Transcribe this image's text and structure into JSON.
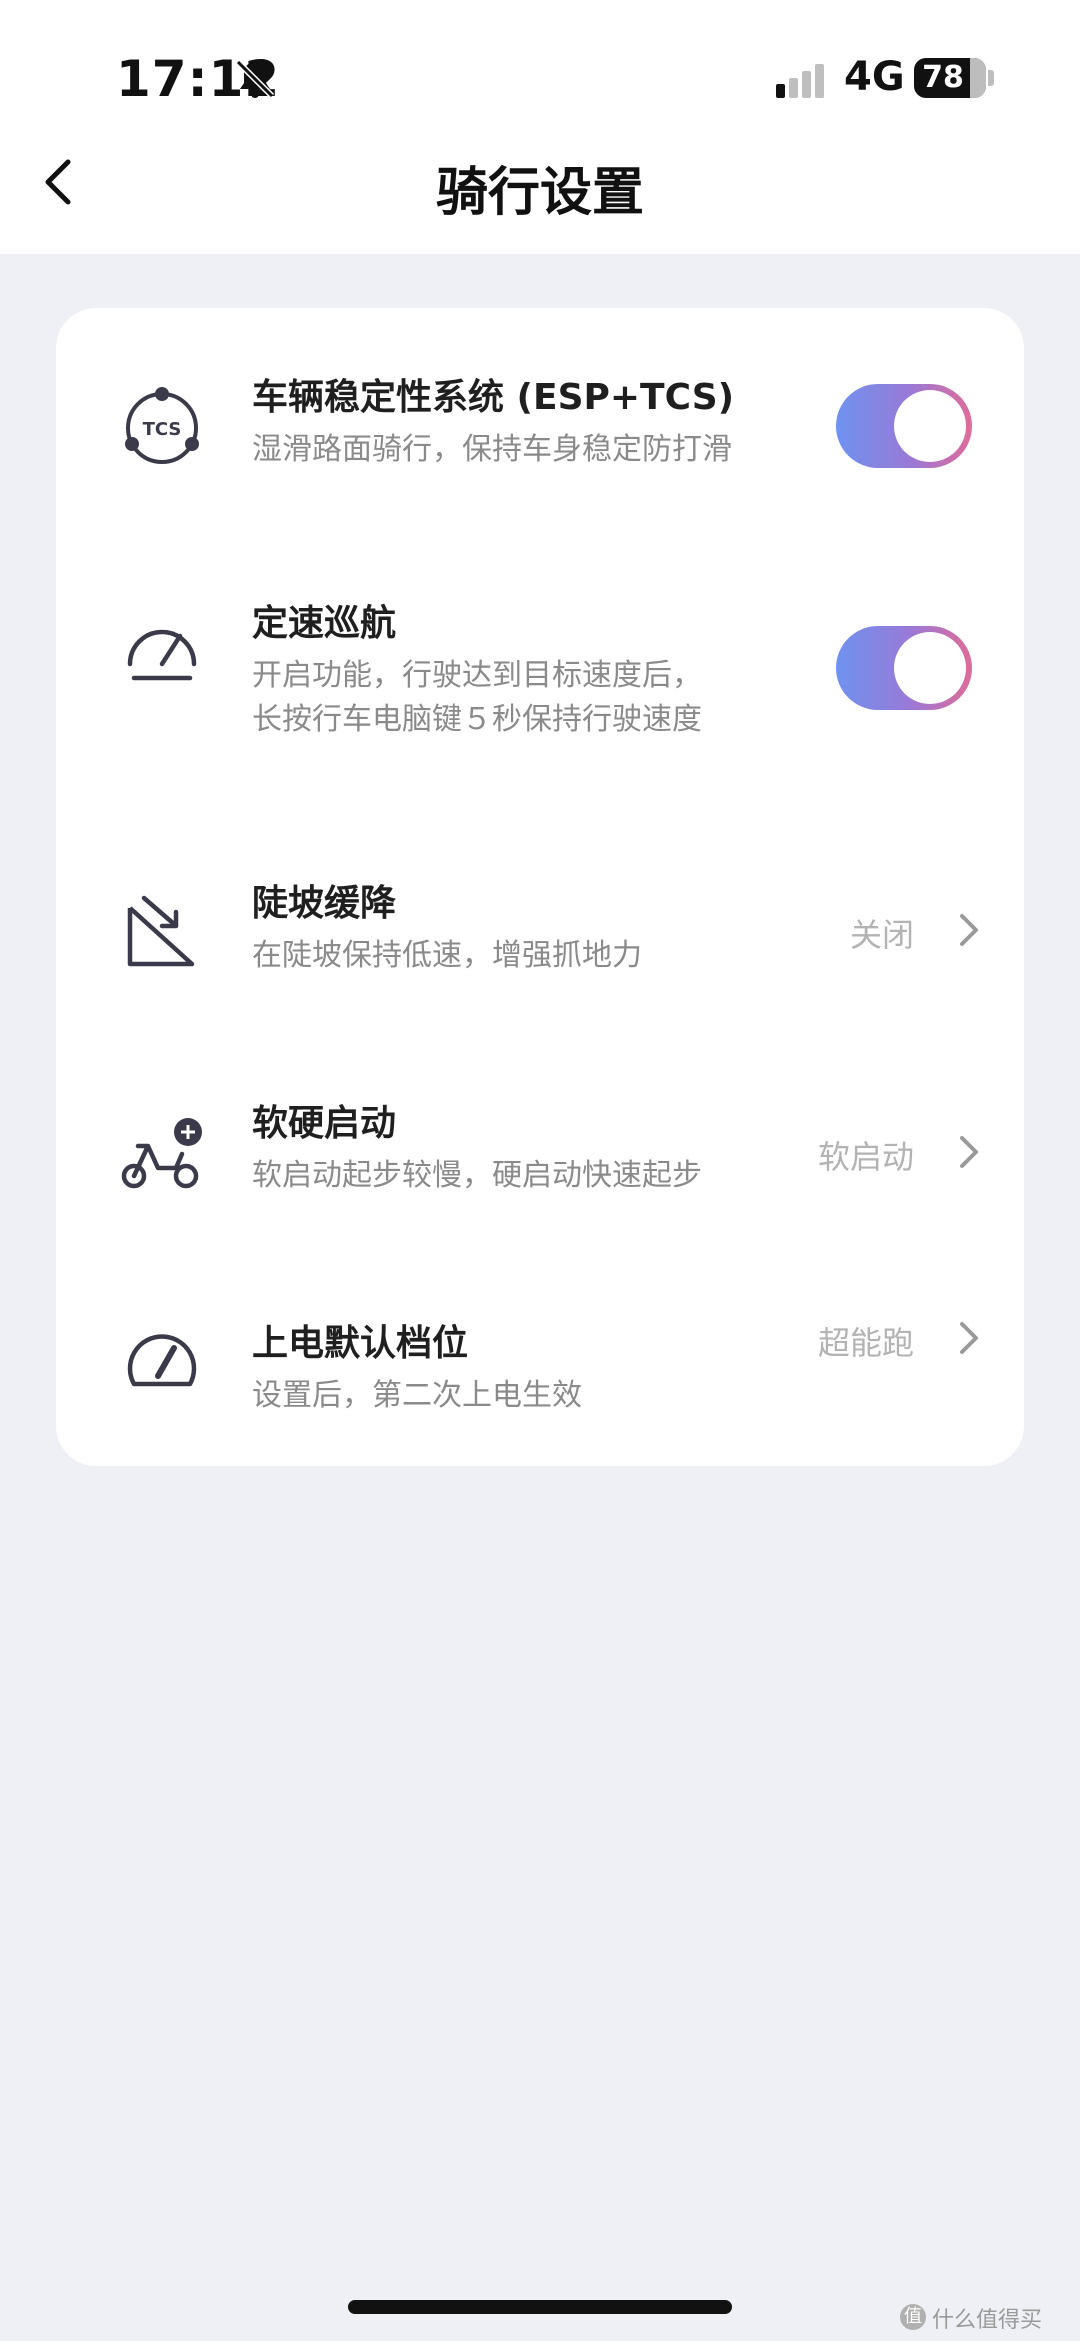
{
  "status_bar": {
    "time": "17:12",
    "network": "4G",
    "battery": "78",
    "battery_level": 0.78
  },
  "header": {
    "title": "骑行设置"
  },
  "settings": [
    {
      "title": "车辆稳定性系统 (ESP+TCS)",
      "desc_lines": [
        "湿滑路面骑行，保持车身稳定防打滑"
      ],
      "icon": "tcs-icon",
      "icon_text": "TCS",
      "toggle_on": true
    },
    {
      "title": "定速巡航",
      "desc_lines": [
        "开启功能，行驶达到目标速度后，",
        "长按行车电脑键５秒保持行驶速度"
      ],
      "icon": "speedometer-icon",
      "toggle_on": true
    },
    {
      "title": "陡坡缓降",
      "desc_lines": [
        "在陡坡保持低速，增强抓地力"
      ],
      "icon": "slope-descent-icon",
      "value": "关闭"
    },
    {
      "title": "软硬启动",
      "desc_lines": [
        "软启动起步较慢，硬启动快速起步"
      ],
      "icon": "scooter-icon",
      "value": "软启动"
    },
    {
      "title": "上电默认档位",
      "desc_lines": [
        "设置后，第二次上电生效"
      ],
      "icon": "gauge-icon",
      "value": "超能跑"
    }
  ],
  "colors": {
    "toggle_start": "#6f92f0",
    "toggle_end": "#e06b9a",
    "background": "#eef0f5"
  },
  "watermark": {
    "logo": "值",
    "text": "什么值得买"
  }
}
